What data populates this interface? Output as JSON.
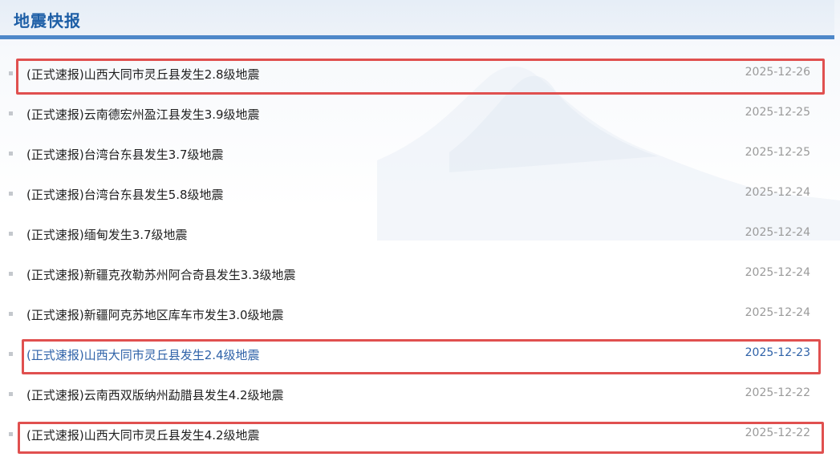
{
  "section": {
    "title": "地震快报"
  },
  "colors": {
    "accent": "#1d5ea6",
    "highlight_box": "#e0504f",
    "active_link": "#2f62a8",
    "date_gray": "#9a9a9a"
  },
  "news": [
    {
      "title": "(正式速报)山西大同市灵丘县发生2.8级地震",
      "date": "2025-12-26",
      "highlighted": true,
      "active": false
    },
    {
      "title": "(正式速报)云南德宏州盈江县发生3.9级地震",
      "date": "2025-12-25",
      "highlighted": false,
      "active": false
    },
    {
      "title": "(正式速报)台湾台东县发生3.7级地震",
      "date": "2025-12-25",
      "highlighted": false,
      "active": false
    },
    {
      "title": "(正式速报)台湾台东县发生5.8级地震",
      "date": "2025-12-24",
      "highlighted": false,
      "active": false
    },
    {
      "title": "(正式速报)缅甸发生3.7级地震",
      "date": "2025-12-24",
      "highlighted": false,
      "active": false
    },
    {
      "title": "(正式速报)新疆克孜勒苏州阿合奇县发生3.3级地震",
      "date": "2025-12-24",
      "highlighted": false,
      "active": false
    },
    {
      "title": "(正式速报)新疆阿克苏地区库车市发生3.0级地震",
      "date": "2025-12-24",
      "highlighted": false,
      "active": false
    },
    {
      "title": "(正式速报)山西大同市灵丘县发生2.4级地震",
      "date": "2025-12-23",
      "highlighted": true,
      "active": true
    },
    {
      "title": "(正式速报)云南西双版纳州勐腊县发生4.2级地震",
      "date": "2025-12-22",
      "highlighted": false,
      "active": false
    },
    {
      "title": "(正式速报)山西大同市灵丘县发生4.2级地震",
      "date": "2025-12-22",
      "highlighted": true,
      "active": false
    }
  ]
}
